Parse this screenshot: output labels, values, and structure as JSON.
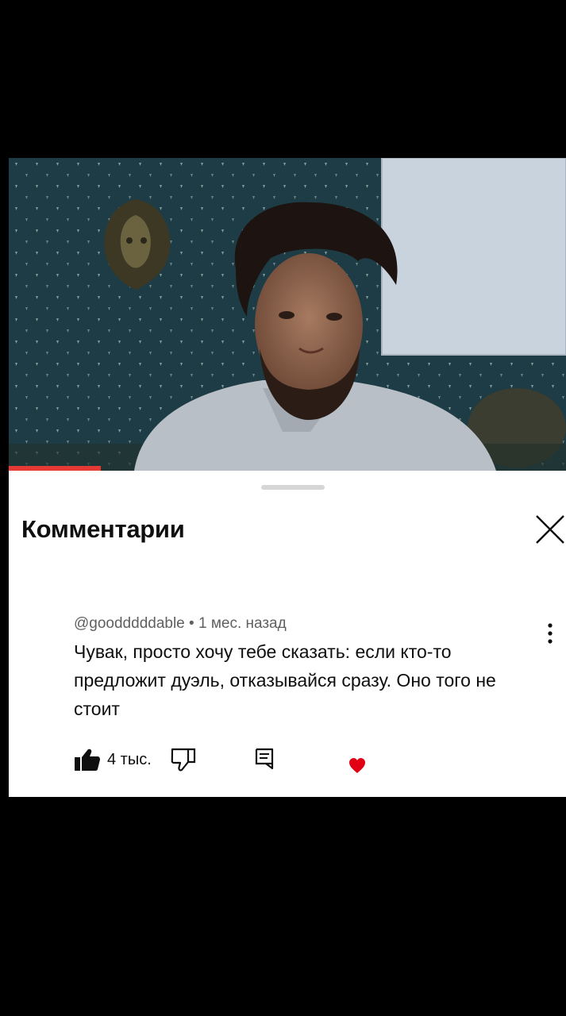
{
  "video": {
    "scene": "person-at-camera"
  },
  "comments_panel": {
    "title": "Комментарии",
    "close_icon": "close-icon",
    "comment": {
      "author": "@goodddddable",
      "separator": "•",
      "time": "1 мес. назад",
      "text": "Чувак, просто хочу тебе сказать: если кто-то предложит дуэль, отказывайся сразу. Оно того не стоит",
      "likes": "4 тыс.",
      "creator_heart": true
    },
    "icons": {
      "like": "thumbs-up-icon",
      "dislike": "thumbs-down-icon",
      "reply": "reply-icon",
      "more": "more-vert-icon",
      "heart": "heart-icon"
    },
    "colors": {
      "heart": "#e10014",
      "sheet": "#ffffff",
      "text": "#0f0f0f",
      "meta": "#606060"
    }
  }
}
